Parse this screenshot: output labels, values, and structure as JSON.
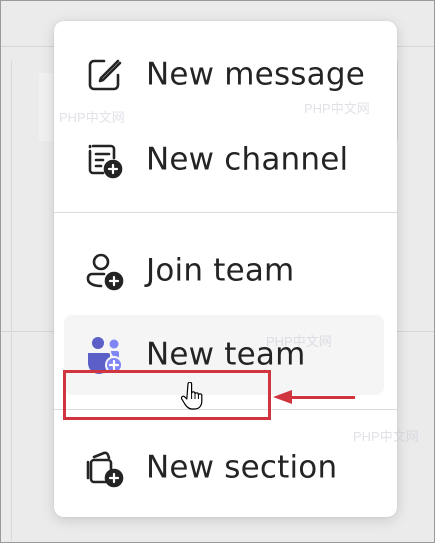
{
  "menu": {
    "items": [
      {
        "id": "new-message",
        "label": "New message",
        "icon": "compose-icon"
      },
      {
        "id": "new-channel",
        "label": "New channel",
        "icon": "channel-add-icon"
      },
      {
        "id": "join-team",
        "label": "Join team",
        "icon": "person-add-icon"
      },
      {
        "id": "new-team",
        "label": "New team",
        "icon": "people-team-add-icon"
      },
      {
        "id": "new-section",
        "label": "New section",
        "icon": "section-add-icon"
      }
    ],
    "hovered_item": "new-team"
  },
  "watermarks": [
    "PHP中文网",
    "PHP中文网",
    "PHP中文网",
    "PHP中文网"
  ],
  "colors": {
    "accent_purple": "#5b5fc7",
    "annotation_red": "#d0343f",
    "text": "#242424"
  }
}
